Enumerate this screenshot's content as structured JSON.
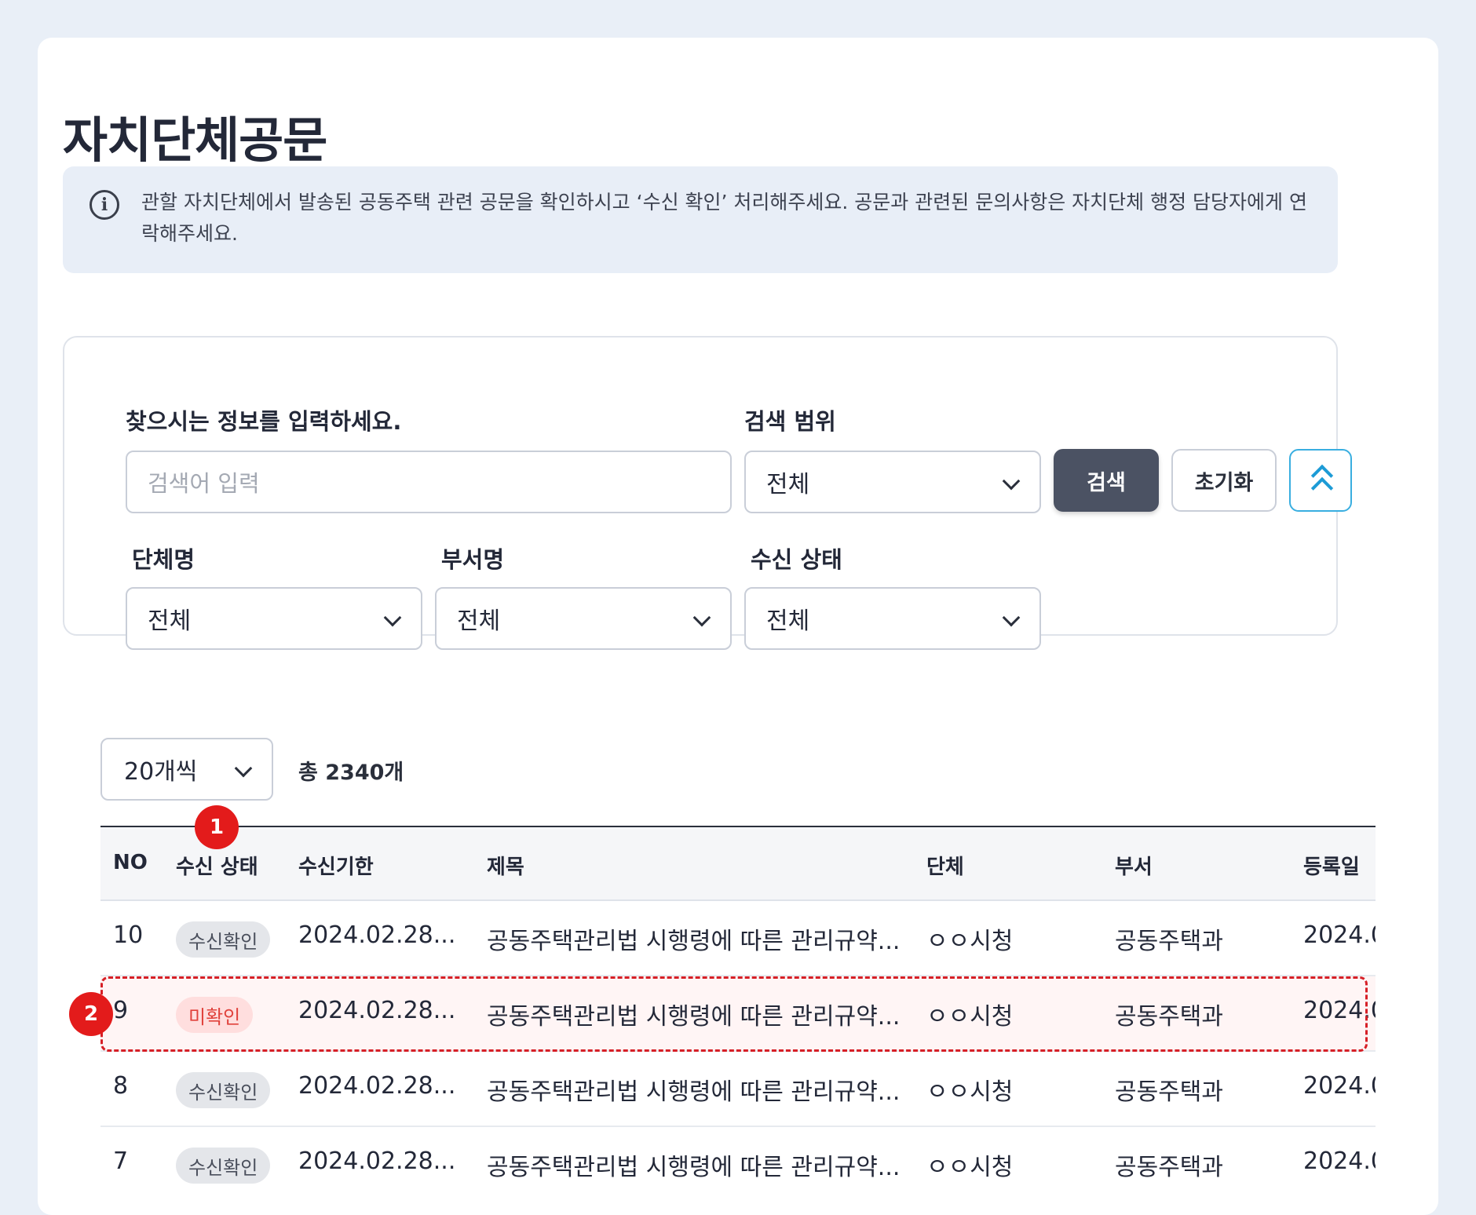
{
  "page": {
    "title": "자치단체공문"
  },
  "notice": {
    "icon": "info-icon",
    "text": "관할 자치단체에서 발송된 공동주택 관련 공문을 확인하시고 ‘수신 확인’ 처리해주세요. 공문과 관련된 문의사항은 자치단체 행정 담당자에게 연락해주세요."
  },
  "search": {
    "keyword_label": "찾으시는 정보를 입력하세요.",
    "keyword_placeholder": "검색어 입력",
    "scope_label": "검색 범위",
    "scope_value": "전체",
    "search_button": "검색",
    "reset_button": "초기화",
    "org_label": "단체명",
    "org_value": "전체",
    "dept_label": "부서명",
    "dept_value": "전체",
    "status_label": "수신 상태",
    "status_value": "전체"
  },
  "list": {
    "page_size": "20개씩",
    "total": "총 2340개"
  },
  "table": {
    "headers": {
      "no": "NO",
      "status": "수신 상태",
      "deadline": "수신기한",
      "title": "제목",
      "org": "단체",
      "dept": "부서",
      "date": "등록일"
    },
    "rows": [
      {
        "no": "10",
        "status": "수신확인",
        "deadline": "2024.02.28...",
        "title": "공동주택관리법 시행령에 따른 관리규약...",
        "org": "ㅇㅇ시청",
        "dept": "공동주택과",
        "date": "2024.0"
      },
      {
        "no": "9",
        "status": "미확인",
        "deadline": "2024.02.28...",
        "title": "공동주택관리법 시행령에 따른 관리규약...",
        "org": "ㅇㅇ시청",
        "dept": "공동주택과",
        "date": "2024.0"
      },
      {
        "no": "8",
        "status": "수신확인",
        "deadline": "2024.02.28...",
        "title": "공동주택관리법 시행령에 따른 관리규약...",
        "org": "ㅇㅇ시청",
        "dept": "공동주택과",
        "date": "2024.0"
      },
      {
        "no": "7",
        "status": "수신확인",
        "deadline": "2024.02.28...",
        "title": "공동주택관리법 시행령에 따른 관리규약...",
        "org": "ㅇㅇ시청",
        "dept": "공동주택과",
        "date": "2024.0"
      }
    ]
  },
  "annotations": {
    "marker_1": "1",
    "marker_2": "2",
    "marker_color": "#e31b1b"
  },
  "colors": {
    "primary_button": "#4b5263",
    "accent": "#1c9bd6",
    "unconfirmed": "#e0413b"
  }
}
